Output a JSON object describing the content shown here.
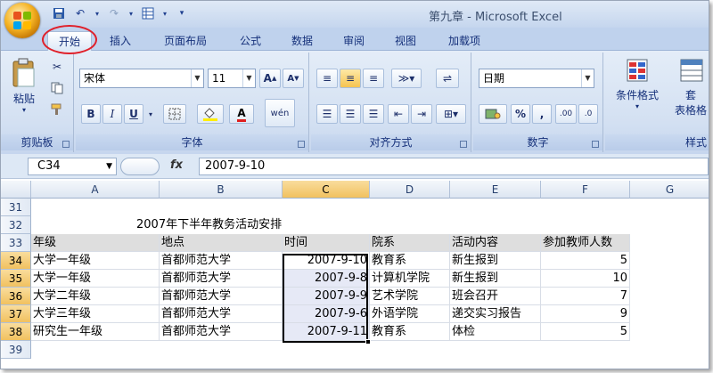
{
  "window": {
    "title": "第九章 - Microsoft Excel"
  },
  "qat": {
    "save": "save-icon",
    "undo": "undo-icon",
    "redo": "redo-icon",
    "table": "table-icon",
    "custom": "▾"
  },
  "tabs": [
    "开始",
    "插入",
    "页面布局",
    "公式",
    "数据",
    "审阅",
    "视图",
    "加载项"
  ],
  "ribbon": {
    "clipboard": {
      "paste_label": "粘贴",
      "group_label": "剪贴板"
    },
    "font": {
      "name": "宋体",
      "size": "11",
      "grow": "A",
      "shrink": "A",
      "bold": "B",
      "italic": "I",
      "underline": "U",
      "color_letter": "A",
      "phonetic": "wén",
      "group_label": "字体"
    },
    "alignment": {
      "group_label": "对齐方式"
    },
    "number": {
      "format": "日期",
      "percent": "%",
      "comma": ",",
      "inc_decimal": ".00",
      "dec_decimal": ".0",
      "group_label": "数字"
    },
    "styles": {
      "conditional_label": "条件格式",
      "table_label_a": "套",
      "table_label_b": "表格格",
      "group_label": "样式"
    }
  },
  "formula_bar": {
    "name_box": "C34",
    "fx": "fx",
    "value": "2007-9-10"
  },
  "columns": [
    "A",
    "B",
    "C",
    "D",
    "E",
    "F",
    "G"
  ],
  "rows": [
    {
      "num": "31",
      "cells": [
        "",
        "",
        "",
        "",
        "",
        "",
        ""
      ]
    },
    {
      "num": "32",
      "cells": [
        "2007年下半年教务活动安排",
        "",
        "",
        "",
        "",
        "",
        ""
      ]
    },
    {
      "num": "33",
      "cells": [
        "年级",
        "地点",
        "时间",
        "院系",
        "活动内容",
        "参加教师人数",
        ""
      ]
    },
    {
      "num": "34",
      "cells": [
        "大学一年级",
        "首都师范大学",
        "2007-9-10",
        "教育系",
        "新生报到",
        "5",
        ""
      ]
    },
    {
      "num": "35",
      "cells": [
        "大学一年级",
        "首都师范大学",
        "2007-9-8",
        "计算机学院",
        "新生报到",
        "10",
        ""
      ]
    },
    {
      "num": "36",
      "cells": [
        "大学二年级",
        "首都师范大学",
        "2007-9-9",
        "艺术学院",
        "班会召开",
        "7",
        ""
      ]
    },
    {
      "num": "37",
      "cells": [
        "大学三年级",
        "首都师范大学",
        "2007-9-6",
        "外语学院",
        "递交实习报告",
        "9",
        ""
      ]
    },
    {
      "num": "38",
      "cells": [
        "研究生一年级",
        "首都师范大学",
        "2007-9-11",
        "教育系",
        "体检",
        "5",
        ""
      ]
    },
    {
      "num": "39",
      "cells": [
        "",
        "",
        "",
        "",
        "",
        "",
        ""
      ]
    }
  ]
}
